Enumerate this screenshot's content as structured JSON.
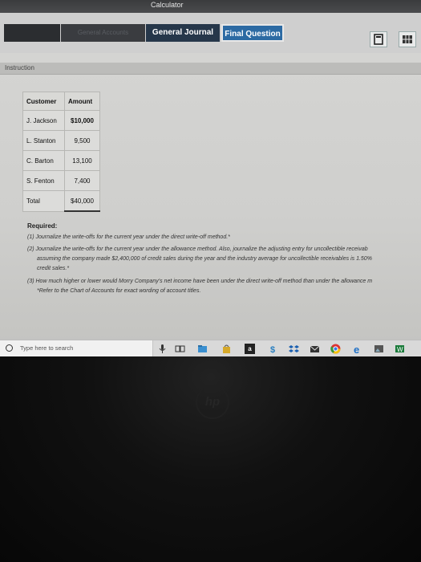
{
  "window": {
    "title": "Calculator"
  },
  "tabs": [
    {
      "label": ""
    },
    {
      "label": "General Accounts"
    },
    {
      "label": "General Journal"
    },
    {
      "label": "Final Question"
    }
  ],
  "section": {
    "label": "Instruction"
  },
  "table": {
    "headers": [
      "Customer",
      "Amount"
    ],
    "rows": [
      {
        "customer": "J. Jackson",
        "amount": "$10,000"
      },
      {
        "customer": "L. Stanton",
        "amount": "9,500"
      },
      {
        "customer": "C. Barton",
        "amount": "13,100"
      },
      {
        "customer": "S. Fenton",
        "amount": "7,400"
      }
    ],
    "total": {
      "label": "Total",
      "amount": "$40,000"
    }
  },
  "required": {
    "heading": "Required:",
    "item1": "(1) Journalize the write-offs for the current year under the direct write-off method.*",
    "item2_line1": "(2) Journalize the write-offs for the current year under the allowance method. Also, journalize the adjusting entry for uncollectible receivab",
    "item2_line2": "assuming the company made $2,400,000 of credit sales during the year and the industry average for uncollectible receivables is 1.50%",
    "item2_line3": "credit sales.*",
    "item3": "(3) How much higher or lower would Morry Company's net income have been under the direct write-off method than under the allowance m",
    "note": "*Refer to the Chart of Accounts for exact wording of account titles."
  },
  "taskbar": {
    "search_placeholder": "Type here to search",
    "store_letter": "a",
    "hp_logo": "hp"
  },
  "colors": {
    "tab_active": "#26374a",
    "tab_blue": "#2c6aa3",
    "taskbar": "#d9d9d9"
  }
}
